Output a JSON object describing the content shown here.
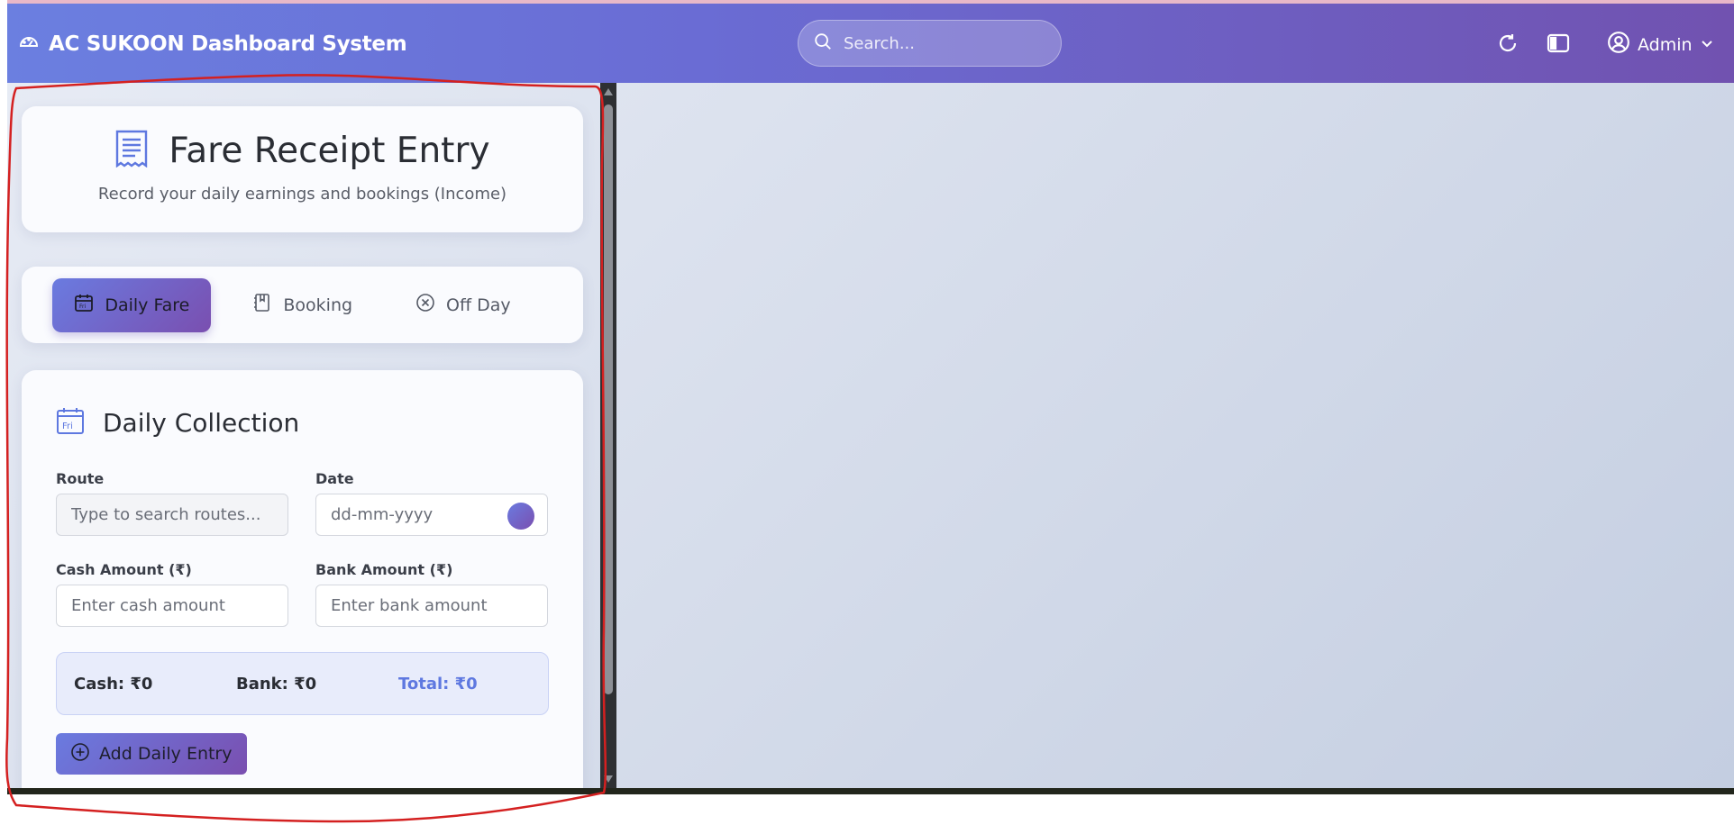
{
  "header": {
    "title": "AC SUKOON Dashboard System",
    "search_placeholder": "Search...",
    "user_label": "Admin"
  },
  "page": {
    "title": "Fare Receipt Entry",
    "subtitle": "Record your daily earnings and bookings (Income)"
  },
  "tabs": [
    {
      "label": "Daily Fare",
      "active": true,
      "icon": "calendar-icon"
    },
    {
      "label": "Booking",
      "active": false,
      "icon": "book-icon"
    },
    {
      "label": "Off Day",
      "active": false,
      "icon": "x-circle-icon"
    }
  ],
  "form": {
    "section_title": "Daily Collection",
    "section_icon_text": "Fri",
    "route_label": "Route",
    "route_placeholder": "Type to search routes...",
    "date_label": "Date",
    "date_placeholder": "dd-mm-yyyy",
    "cash_label": "Cash Amount (₹)",
    "cash_placeholder": "Enter cash amount",
    "bank_label": "Bank Amount (₹)",
    "bank_placeholder": "Enter bank amount",
    "totals": {
      "cash": "Cash: ₹0",
      "bank": "Bank: ₹0",
      "total": "Total: ₹0"
    },
    "add_button": "Add Daily Entry"
  },
  "colors": {
    "accent": "#6a7be0",
    "accent_end": "#7a4fb0",
    "total_text": "#5e78e0",
    "annotation": "#d42020"
  }
}
